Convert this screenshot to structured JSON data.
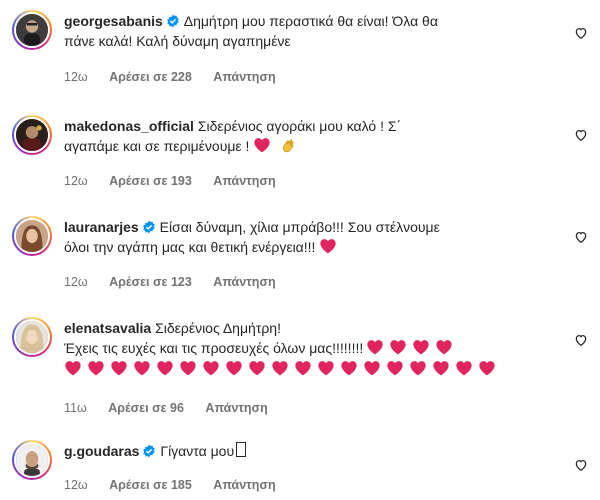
{
  "comments": [
    {
      "username": "georgesabanis",
      "verified": true,
      "lines": [
        "Δημήτρη μου περαστικά θα είναι! Όλα θα",
        "πάνε καλά! Καλή δύναμη αγαπημένε"
      ],
      "time": "12ω",
      "likes": "Αρέσει σε 228",
      "reply": "Απάντηση"
    },
    {
      "username": "makedonas_official",
      "verified": false,
      "lines": [
        "Σιδερένιος αγοράκι μου καλό ! Σ΄",
        "αγαπάμε και σε περιμένουμε !"
      ],
      "emojis": [
        "red-heart",
        "clapping-hands"
      ],
      "time": "12ω",
      "likes": "Αρέσει σε 193",
      "reply": "Απάντηση"
    },
    {
      "username": "lauranarjes",
      "verified": true,
      "lines": [
        "Είσαι δύναμη, χίλια μπράβο!!! Σου στέλνουμε",
        "όλοι την αγάπη μας και θετική ενέργεια!!!"
      ],
      "emojis": [
        "red-heart"
      ],
      "time": "12ω",
      "likes": "Αρέσει σε 123",
      "reply": "Απάντηση"
    },
    {
      "username": "elenatsavalia",
      "verified": false,
      "lines": [
        "Σιδερένιος Δημήτρη!",
        "Έχεις τις ευχές και τις προσευχές όλων μας!!!!!!!!"
      ],
      "hearts_inline": 4,
      "hearts_row": 19,
      "time": "11ω",
      "likes": "Αρέσει σε 96",
      "reply": "Απάντηση"
    },
    {
      "username": "g.goudaras",
      "verified": true,
      "lines": [
        "Γίγαντα μου"
      ],
      "time": "12ω",
      "likes": "Αρέσει σε 185",
      "reply": "Απάντηση"
    }
  ],
  "colors": {
    "text": "#262626",
    "meta": "#737373",
    "verified": "#0095f6",
    "heart": "#e0245e"
  },
  "icons": {
    "like": "heart-outline-icon",
    "verified": "verified-badge-icon"
  }
}
